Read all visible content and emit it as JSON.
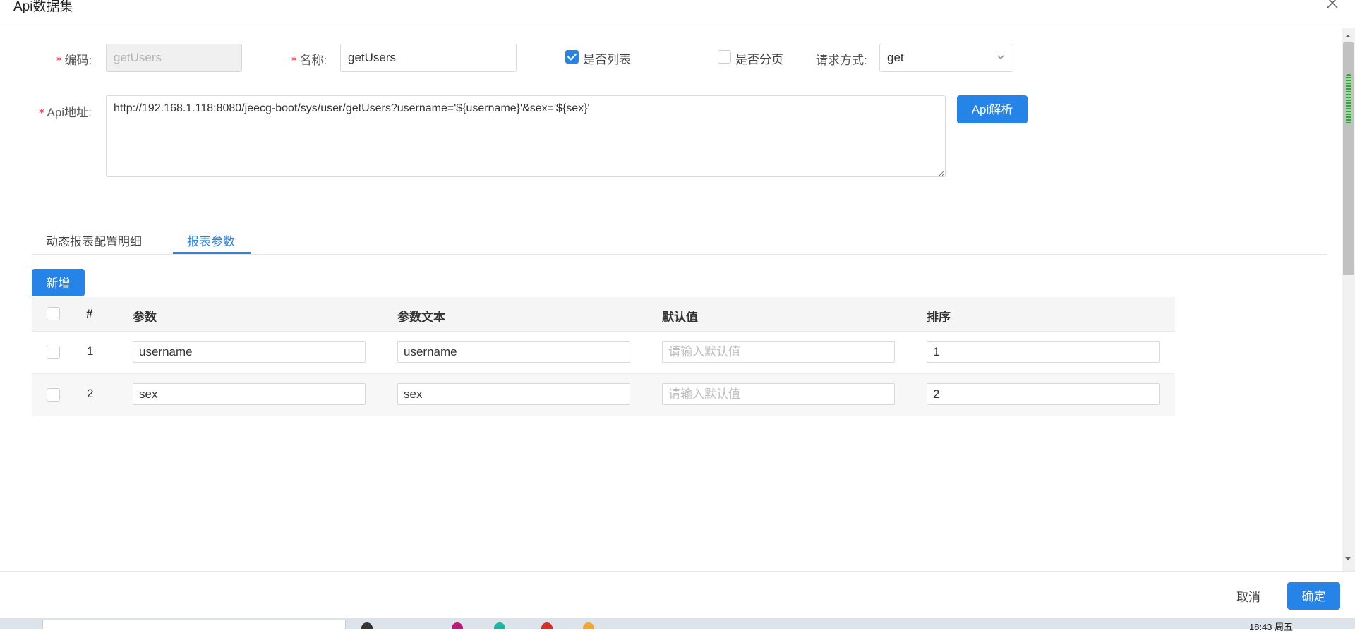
{
  "modal": {
    "title": "Api数据集",
    "close_icon": "close-icon"
  },
  "form": {
    "required_mark": "*",
    "code": {
      "label": "编码:",
      "value": "getUsers",
      "disabled": true
    },
    "name": {
      "label": "名称:",
      "value": "getUsers"
    },
    "is_list": {
      "label": "是否列表",
      "checked": true
    },
    "is_paged": {
      "label": "是否分页",
      "checked": false
    },
    "method": {
      "label": "请求方式:",
      "value": "get",
      "icon": "chevron-down-icon"
    },
    "api_url": {
      "label": "Api地址:",
      "value": "http://192.168.1.118:8080/jeecg-boot/sys/user/getUsers?username='${username}'&sex='${sex}'"
    },
    "parse_button": "Api解析"
  },
  "tabs": [
    {
      "label": "动态报表配置明细",
      "active": false
    },
    {
      "label": "报表参数",
      "active": true
    }
  ],
  "table": {
    "add_button": "新增",
    "columns": [
      "#",
      "参数",
      "参数文本",
      "默认值",
      "排序"
    ],
    "default_placeholder": "请输入默认值",
    "rows": [
      {
        "index": "1",
        "param": "username",
        "param_text": "username",
        "default": "",
        "order": "1"
      },
      {
        "index": "2",
        "param": "sex",
        "param_text": "sex",
        "default": "",
        "order": "2"
      }
    ]
  },
  "footer": {
    "cancel": "取消",
    "confirm": "确定"
  },
  "taskbar": {
    "clock": "18:43 周五"
  },
  "colors": {
    "primary": "#2684e9",
    "required": "#f5222d"
  }
}
